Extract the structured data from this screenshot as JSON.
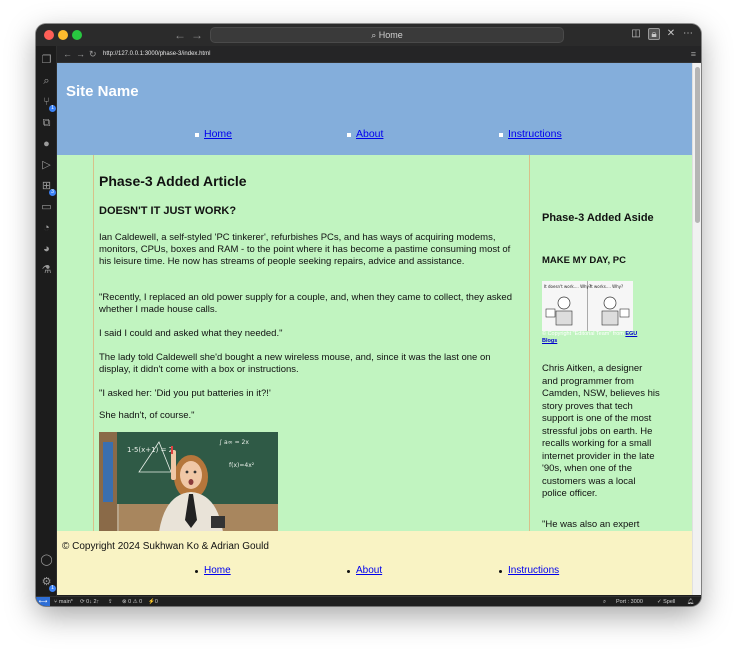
{
  "window": {
    "title": "Home",
    "search_icon": "search-icon"
  },
  "browser": {
    "url": "http://127.0.0.1:3000/phase-3/index.html"
  },
  "site": {
    "name": "Site Name",
    "nav": [
      "Home",
      "About",
      "Instructions"
    ]
  },
  "article": {
    "title": "Phase-3 Added Article",
    "subtitle": "DOESN'T IT JUST WORK?",
    "paragraphs": [
      "Ian Caldewell, a self-styled 'PC tinkerer', refurbishes PCs, and has ways of acquiring modems, monitors, CPUs, boxes and RAM - to the point where it has become a pastime consuming most of his leisure time. He now has streams of people seeking repairs, advice and assistance.",
      "\"Recently, I replaced an old power supply for a couple, and, when they came to collect, they asked whether I made house calls.",
      "I said I could and asked what they needed.\"",
      "The lady told Caldewell she'd bought a new wireless mouse, and, since it was the last one on display, it didn't come with a box or instructions.",
      "\"I asked her: 'Did you put batteries in it?!'",
      "She hadn't, of course.\""
    ]
  },
  "aside": {
    "title": "Phase-3 Added Aside",
    "subtitle": "MAKE MY DAY, PC",
    "comic_panel_left": "It doesn't work.... Why?",
    "comic_panel_right": "It works.... Why?",
    "caption_prefix": "© Copyright \"Editorial Team\" from ",
    "caption_link": "EGU Blogs",
    "paragraphs": [
      "Chris Aitken, a designer and programmer from Camden, NSW, believes his story proves that tech support is one of the most stressful jobs on earth. He recalls working for a small internet provider in the late '90s, when one of the customers was a local police officer.",
      "\"He was also an expert"
    ]
  },
  "footer": {
    "copyright": "© Copyright 2024 Sukhwan Ko & Adrian Gould",
    "nav": [
      "Home",
      "About",
      "Instructions"
    ]
  },
  "statusbar": {
    "branch": "main*",
    "sync": "0↓ 2↑",
    "problems": "⊗ 0 ⚠ 0",
    "ports": "⚡0",
    "port_label": "Port : 3000",
    "spell": "Spell"
  },
  "colors": {
    "header_bg": "#84aedb",
    "main_bg": "#c1f4c0",
    "footer_bg": "#f9f3c4",
    "link": "#0000ee"
  }
}
